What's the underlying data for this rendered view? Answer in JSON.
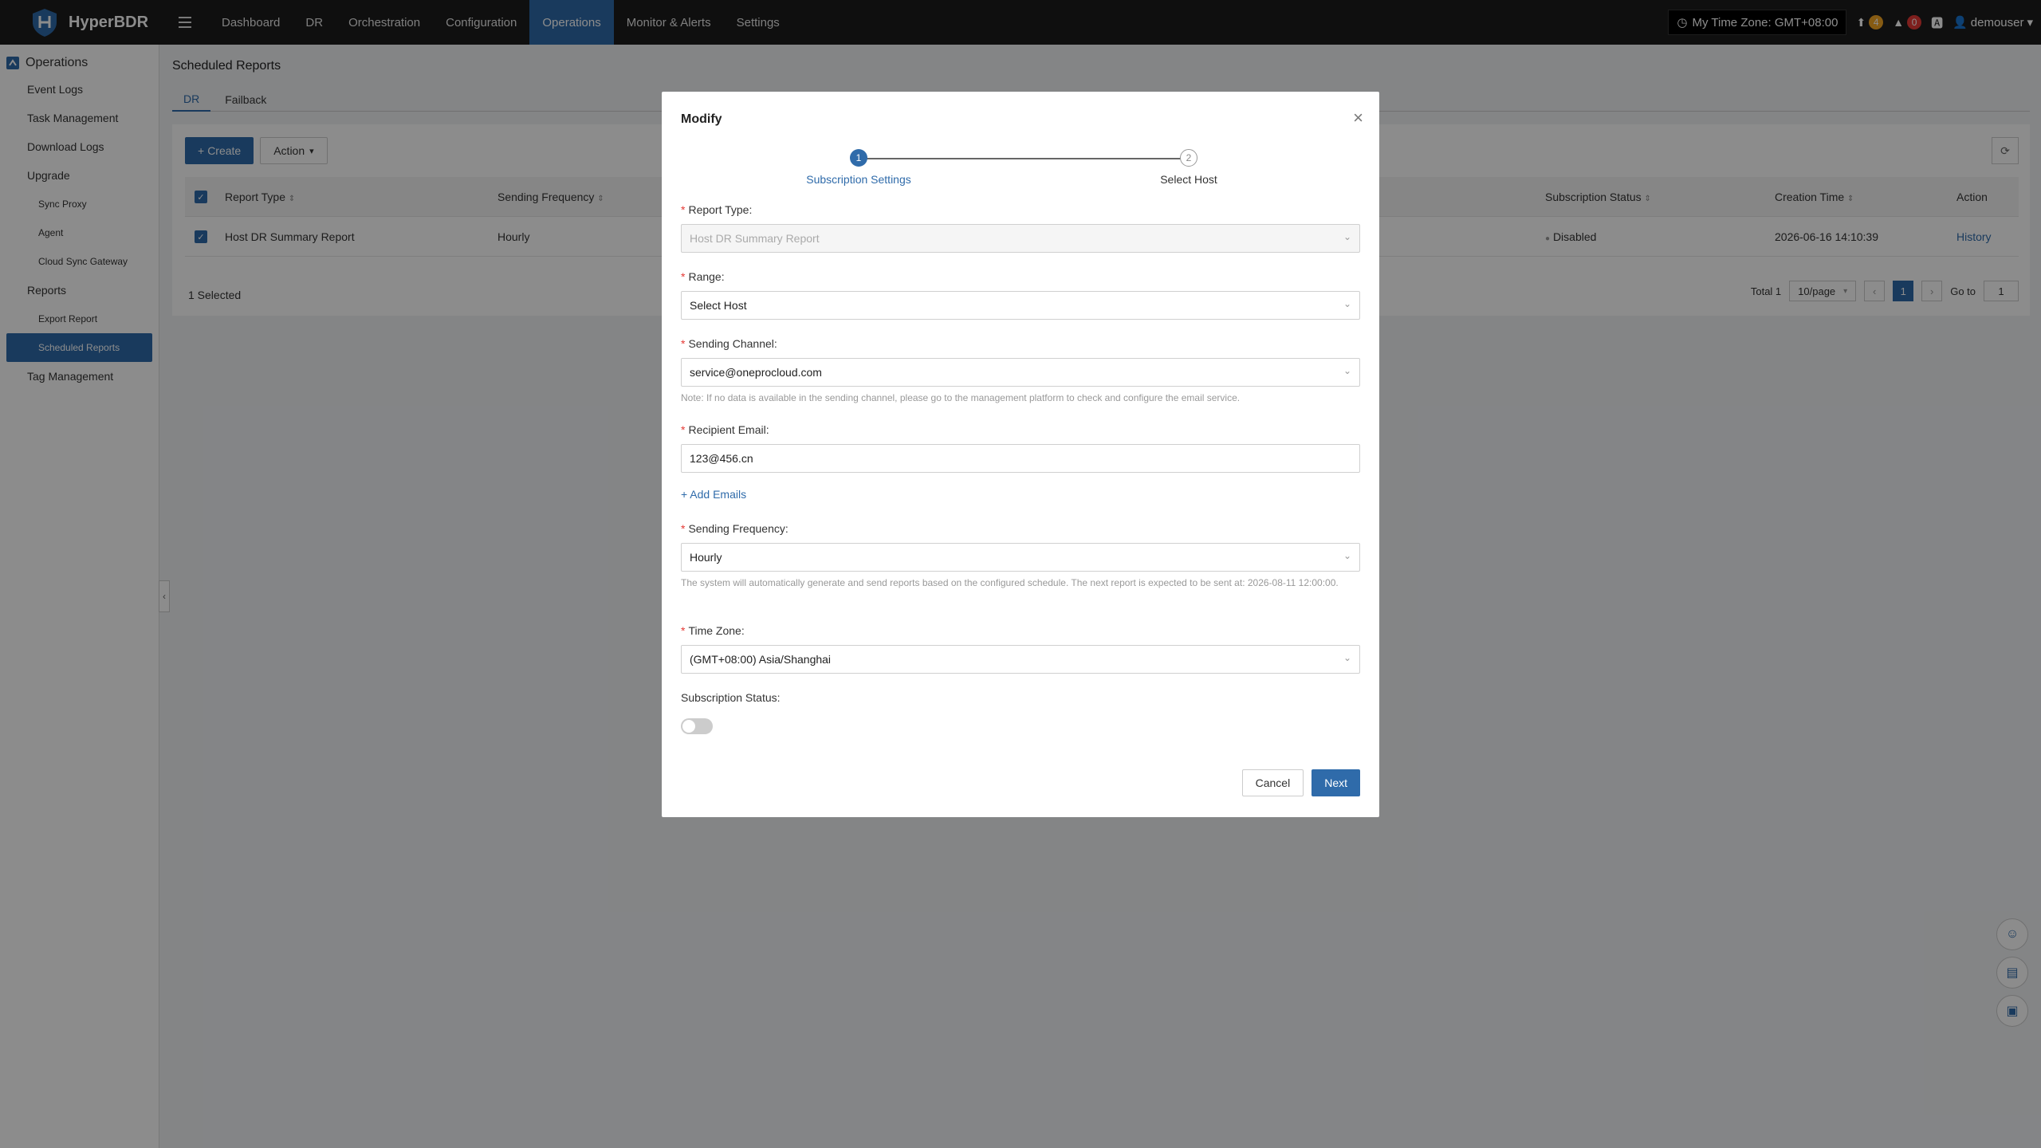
{
  "app": {
    "name": "HyperBDR"
  },
  "nav": [
    {
      "label": "Dashboard",
      "active": false
    },
    {
      "label": "DR",
      "active": false
    },
    {
      "label": "Orchestration",
      "active": false
    },
    {
      "label": "Configuration",
      "active": false
    },
    {
      "label": "Operations",
      "active": true
    },
    {
      "label": "Monitor & Alerts",
      "active": false
    },
    {
      "label": "Settings",
      "active": false
    }
  ],
  "topright": {
    "timezone": "My Time Zone: GMT+08:00",
    "upgrade_count": "4",
    "alert_count": "0",
    "user": "demouser"
  },
  "sidebar": {
    "title": "Operations",
    "items": [
      {
        "label": "Event Logs"
      },
      {
        "label": "Task Management"
      },
      {
        "label": "Download Logs"
      },
      {
        "label": "Upgrade"
      },
      {
        "label": "Sync Proxy"
      },
      {
        "label": "Agent"
      },
      {
        "label": "Cloud Sync Gateway"
      },
      {
        "label": "Reports"
      },
      {
        "label": "Export Report"
      },
      {
        "label": "Scheduled Reports"
      },
      {
        "label": "Tag Management"
      }
    ]
  },
  "page": {
    "title": "Scheduled Reports",
    "tabs": [
      "DR",
      "Failback"
    ],
    "create_label": "Create",
    "action_label": "Action",
    "columns": [
      "Report Type",
      "Sending Frequency",
      "Subscription Status",
      "Creation Time",
      "Action"
    ],
    "rows": [
      {
        "type": "Host DR Summary Report",
        "frequency": "Hourly",
        "status": "Disabled",
        "created": "2026-06-16 14:10:39",
        "action": "History"
      }
    ],
    "selected": "1 Selected",
    "total": "Total 1",
    "page_size": "10/page",
    "current_page": "1",
    "goto_label": "Go to",
    "goto_value": "1"
  },
  "modal": {
    "title": "Modify",
    "steps": [
      {
        "num": "1",
        "label": "Subscription Settings"
      },
      {
        "num": "2",
        "label": "Select Host"
      }
    ],
    "report_type": {
      "label": "Report Type:",
      "value": "Host DR Summary Report"
    },
    "range": {
      "label": "Range:",
      "value": "Select Host"
    },
    "channel": {
      "label": "Sending Channel:",
      "value": "service@oneprocloud.com",
      "note": "Note: If no data is available in the sending channel, please go to the management platform to check and configure the email service."
    },
    "recipient": {
      "label": "Recipient Email:",
      "value": "123@456.cn"
    },
    "add_emails": "Add Emails",
    "frequency": {
      "label": "Sending Frequency:",
      "value": "Hourly",
      "note": "The system will automatically generate and send reports based on the configured schedule. The next report is expected to be sent at: 2026-08-11 12:00:00."
    },
    "timezone": {
      "label": "Time Zone:",
      "value": "(GMT+08:00) Asia/Shanghai"
    },
    "subscription_status": {
      "label": "Subscription Status:",
      "enabled": false
    },
    "cancel_label": "Cancel",
    "next_label": "Next"
  },
  "colors": {
    "accent": "#2f6baa",
    "topbar": "#1c1c1c",
    "danger": "#e53935",
    "warning": "#f5a623"
  }
}
